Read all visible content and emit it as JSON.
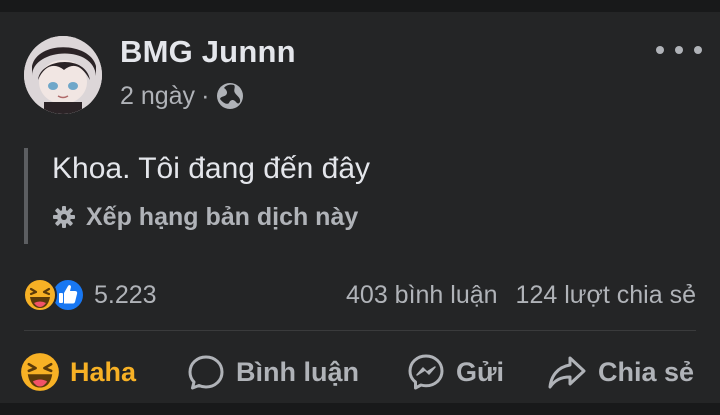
{
  "post": {
    "author": "BMG Junnn",
    "time": "2 ngày",
    "separator": "·",
    "privacy_icon": "globe-icon",
    "text": "Khoa. Tôi đang đến đây",
    "translate_label": "Xếp hạng bản dịch này"
  },
  "engagement": {
    "reaction_icons": [
      "haha-icon",
      "like-icon"
    ],
    "reaction_count": "5.223",
    "comments": "403 bình luận",
    "shares": "124 lượt chia sẻ"
  },
  "actions": {
    "haha": "Haha",
    "comment": "Bình luận",
    "send": "Gửi",
    "share": "Chia sẻ"
  },
  "colors": {
    "background": "#18191a",
    "card": "#242526",
    "primary_text": "#e4e6eb",
    "secondary_text": "#b0b3b8",
    "haha_accent": "#f7b125",
    "like_blue": "#1877f2"
  }
}
